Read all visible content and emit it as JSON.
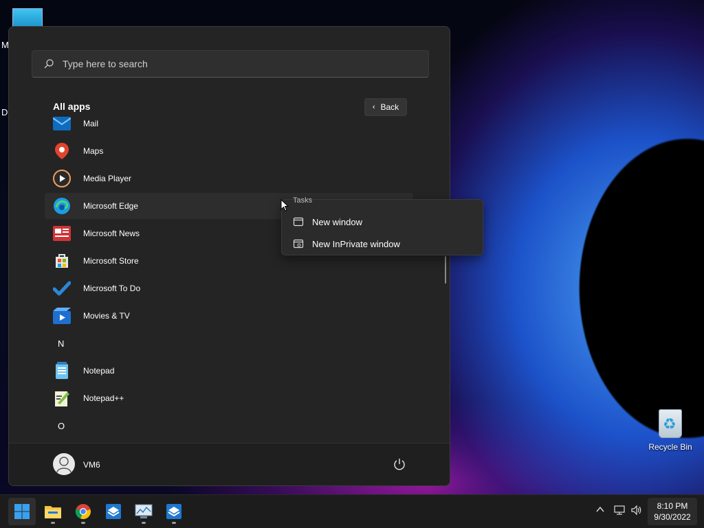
{
  "desktop": {
    "partial_labels": [
      "M",
      "Da"
    ],
    "recycle_bin_label": "Recycle Bin"
  },
  "start_menu": {
    "search_placeholder": "Type here to search",
    "all_apps_title": "All apps",
    "back_label": "Back",
    "apps": [
      {
        "type": "app",
        "label": "Mail",
        "icon": "mail-icon"
      },
      {
        "type": "app",
        "label": "Maps",
        "icon": "maps-icon"
      },
      {
        "type": "app",
        "label": "Media Player",
        "icon": "media-player-icon"
      },
      {
        "type": "app",
        "label": "Microsoft Edge",
        "icon": "edge-icon"
      },
      {
        "type": "app",
        "label": "Microsoft News",
        "icon": "news-icon"
      },
      {
        "type": "app",
        "label": "Microsoft Store",
        "icon": "store-icon"
      },
      {
        "type": "app",
        "label": "Microsoft To Do",
        "icon": "todo-icon"
      },
      {
        "type": "app",
        "label": "Movies & TV",
        "icon": "movies-tv-icon"
      },
      {
        "type": "letter",
        "label": "N"
      },
      {
        "type": "app",
        "label": "Notepad",
        "icon": "notepad-icon"
      },
      {
        "type": "app",
        "label": "Notepad++",
        "icon": "notepadpp-icon"
      },
      {
        "type": "letter",
        "label": "O"
      }
    ],
    "user_name": "VM6"
  },
  "context_menu": {
    "header": "Tasks",
    "items": [
      {
        "label": "New window",
        "icon": "window-icon"
      },
      {
        "label": "New InPrivate window",
        "icon": "inprivate-window-icon"
      }
    ]
  },
  "taskbar": {
    "time": "8:10 PM",
    "date": "9/30/2022"
  },
  "colors": {
    "start_bg": "#242424",
    "taskbar_bg": "#1c1c1c",
    "accent": "#0078d4"
  }
}
